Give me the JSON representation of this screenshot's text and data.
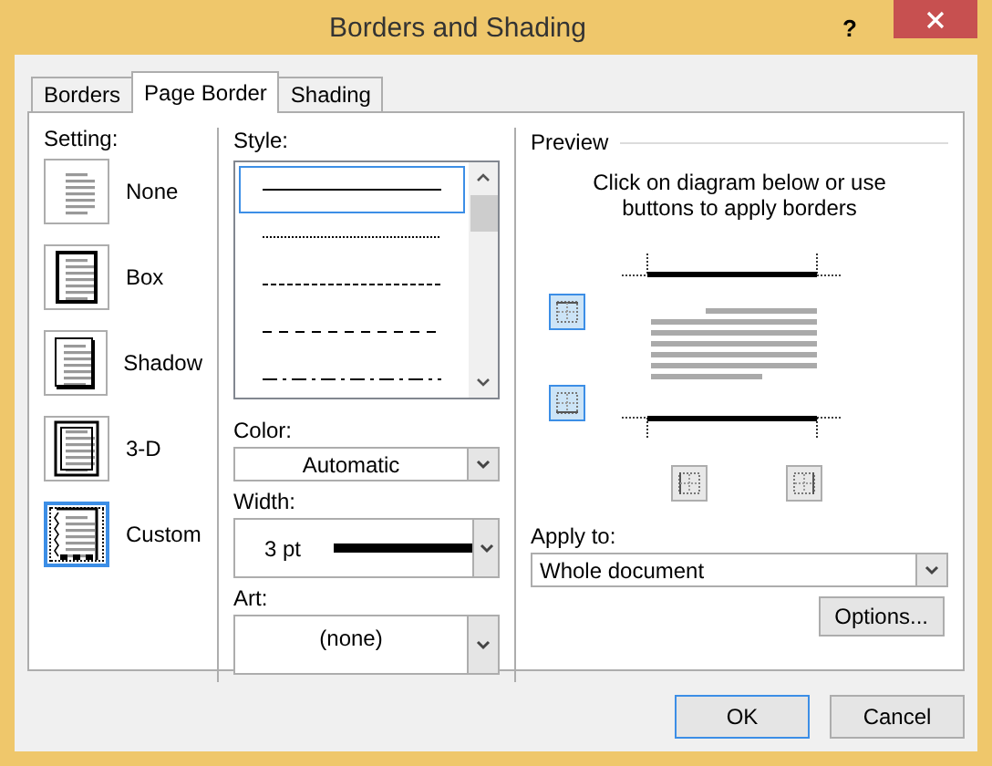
{
  "window": {
    "title": "Borders and Shading",
    "help": "?"
  },
  "tabs": [
    {
      "label": "Borders",
      "selected": false
    },
    {
      "label": "Page Border",
      "selected": true
    },
    {
      "label": "Shading",
      "selected": false
    }
  ],
  "setting": {
    "label": "Setting:",
    "items": [
      {
        "kind": "none",
        "label": "None",
        "selected": false
      },
      {
        "kind": "box",
        "label": "Box",
        "selected": false
      },
      {
        "kind": "shadow",
        "label": "Shadow",
        "selected": false
      },
      {
        "kind": "threed",
        "label": "3-D",
        "selected": false
      },
      {
        "kind": "custom",
        "label": "Custom",
        "selected": true
      }
    ]
  },
  "style": {
    "label": "Style:",
    "items": [
      {
        "kind": "solid",
        "selected": true
      },
      {
        "kind": "dotted",
        "selected": false
      },
      {
        "kind": "fine-dash",
        "selected": false
      },
      {
        "kind": "dash",
        "selected": false
      },
      {
        "kind": "dash-dot",
        "selected": false
      }
    ]
  },
  "color": {
    "label": "Color:",
    "value": "Automatic"
  },
  "width": {
    "label": "Width:",
    "value": "3 pt"
  },
  "art": {
    "label": "Art:",
    "value": "(none)"
  },
  "preview": {
    "label": "Preview",
    "hint": "Click on diagram below or use buttons to apply borders",
    "side_buttons": [
      {
        "kind": "top",
        "selected": true
      },
      {
        "kind": "bottom",
        "selected": true
      },
      {
        "kind": "left",
        "selected": false
      },
      {
        "kind": "right",
        "selected": false
      }
    ]
  },
  "apply_to": {
    "label": "Apply to:",
    "value": "Whole document"
  },
  "options_button": "Options...",
  "buttons": [
    "OK",
    "Cancel"
  ]
}
